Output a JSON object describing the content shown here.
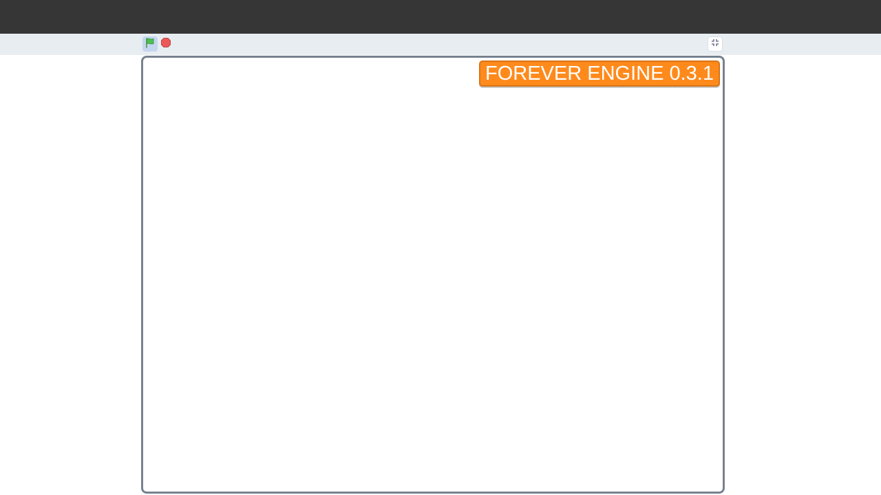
{
  "topbar": {},
  "controls": {
    "green_flag_icon": "green-flag-icon",
    "stop_icon": "stop-sign-icon",
    "fullscreen_icon": "exit-fullscreen-icon",
    "colors": {
      "flag_green": "#4cbf56",
      "stop_red": "#ec5959",
      "toolbar_bg": "#e8edf1",
      "topbar_bg": "#363636"
    }
  },
  "stage": {
    "badge_text": "FOREVER ENGINE 0.3.1",
    "badge_color": "#ff8a1c"
  }
}
